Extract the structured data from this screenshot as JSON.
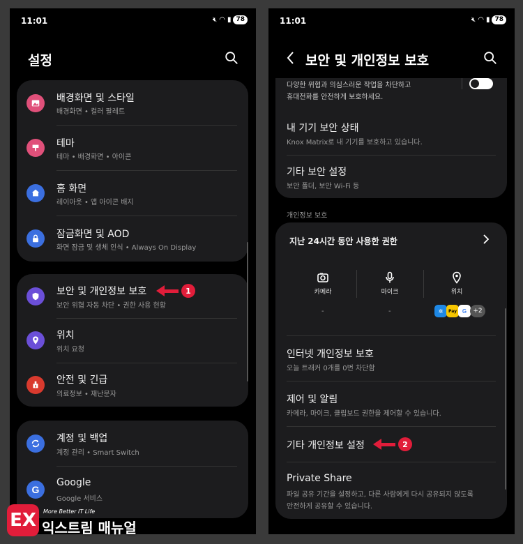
{
  "status": {
    "time": "11:01",
    "battery": "78"
  },
  "left": {
    "title": "설정",
    "cards": [
      {
        "items": [
          {
            "title": "배경화면 및 스타일",
            "sub": "배경화면 • 컬러 팔레트",
            "color": "#e0507a",
            "icon": "image-icon"
          },
          {
            "title": "테마",
            "sub": "테마 • 배경화면 • 아이콘",
            "color": "#e0507a",
            "icon": "theme-brush-icon"
          },
          {
            "title": "홈 화면",
            "sub": "레이아웃 • 앱 아이콘 배지",
            "color": "#3b6fe0",
            "icon": "home-icon"
          },
          {
            "title": "잠금화면 및 AOD",
            "sub": "화면 잠금 및 생체 인식 • Always On Display",
            "color": "#3b6fe0",
            "icon": "lock-icon"
          }
        ]
      },
      {
        "items": [
          {
            "title": "보안 및 개인정보 보호",
            "sub": "보안 위협 자동 차단 • 권한 사용 현황",
            "color": "#6b4fd8",
            "icon": "shield-icon"
          },
          {
            "title": "위치",
            "sub": "위치 요청",
            "color": "#6b4fd8",
            "icon": "location-pin-icon"
          },
          {
            "title": "안전 및 긴급",
            "sub": "의료정보 • 재난문자",
            "color": "#d93a2e",
            "icon": "emergency-icon"
          }
        ]
      },
      {
        "items": [
          {
            "title": "계정 및 백업",
            "sub": "계정 관리 • Smart Switch",
            "color": "#3b6fe0",
            "icon": "sync-icon"
          },
          {
            "title": "Google",
            "sub": "Google 서비스",
            "color": "#3b6fe0",
            "icon": "google-icon"
          }
        ]
      }
    ],
    "annotation": "1"
  },
  "right": {
    "title": "보안 및 개인정보 보호",
    "top_card": [
      {
        "title": "다양한 위협과 의심스러운 작업을 차단하고",
        "sub": "휴대전화를 안전하게 보호하세요."
      },
      {
        "title": "내 기기 보안 상태",
        "sub": "Knox Matrix로 내 기기를 보호하고 있습니다."
      },
      {
        "title": "기타 보안 설정",
        "sub": "보안 폴더, 보안 Wi-Fi 등"
      }
    ],
    "section_label": "개인정보 보호",
    "permissions": {
      "title": "지난 24시간 동안 사용한 권한",
      "cols": [
        {
          "label": "카메라",
          "icon": "camera-icon",
          "value": "-"
        },
        {
          "label": "마이크",
          "icon": "microphone-icon",
          "value": "-"
        },
        {
          "label": "위치",
          "icon": "location-pin-icon",
          "value": ""
        }
      ],
      "apps": [
        "✲",
        "Pay",
        "G"
      ],
      "more": "+2"
    },
    "items": [
      {
        "title": "인터넷 개인정보 보호",
        "sub": "오늘 트래커 0개를 0번 차단함"
      },
      {
        "title": "제어 및 알림",
        "sub": "카메라, 마이크, 클립보드 권한을 제어할 수 있습니다."
      },
      {
        "title": "기타 개인정보 설정",
        "sub": ""
      },
      {
        "title": "Private Share",
        "sub": "파일 공유 기간을 설정하고, 다른 사람에게 다시 공유되지 않도록",
        "sub2": "안전하게 공유할 수 있습니다."
      }
    ],
    "annotation": "2"
  },
  "logo": {
    "mark": "EX",
    "tagline": "More Better IT Life",
    "name": "익스트림 매뉴얼"
  }
}
